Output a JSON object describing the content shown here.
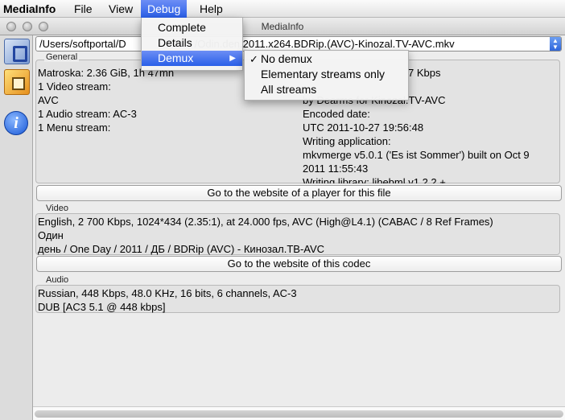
{
  "menubar": {
    "app_name": "MediaInfo",
    "items": [
      "File",
      "View",
      "Debug",
      "Help"
    ]
  },
  "window": {
    "title": "MediaInfo"
  },
  "path": {
    "value": "/Users/softportal/D",
    "value_tail": "/Odin.den.2011.x264.BDRip.(AVC)-Kinozal.TV-AVC.mkv"
  },
  "general": {
    "label": "General",
    "left_lines": [
      "Matroska: 2.36 GiB, 1h 47mn",
      "1 Video stream:",
      "AVC",
      "1 Audio stream: AC-3",
      "1 Menu stream:"
    ],
    "right_lines": [
      "7 Kbps",
      "by Dearms for Kinozal.TV-AVC",
      "Encoded date:",
      "UTC 2011-10-27 19:56:48",
      "Writing application:",
      "mkvmerge v5.0.1 ('Es ist Sommer') built on Oct  9",
      "2011 11:55:43",
      "Writing library: libebml v1.2.2 +"
    ],
    "button": "Go to the website of a player for this file"
  },
  "video": {
    "label": "Video",
    "lines": [
      "English, 2 700 Kbps, 1024*434 (2.35:1), at 24.000 fps, AVC (High@L4.1) (CABAC / 8 Ref Frames)",
      "Один",
      "день / One Day / 2011 / ДБ / BDRip (AVC) - Кинозал.ТВ-AVC"
    ],
    "button": "Go to the website of this codec"
  },
  "audio": {
    "label": "Audio",
    "lines": [
      "Russian, 448 Kbps, 48.0 KHz, 16 bits, 6 channels, AC-3",
      "DUB [AC3 5.1 @ 448 kbps]"
    ]
  },
  "debug_menu": {
    "items": [
      "Complete",
      "Details",
      "Demux"
    ],
    "highlighted": "Demux"
  },
  "demux_submenu": {
    "items": [
      "No demux",
      "Elementary streams only",
      "All streams"
    ],
    "checked": "No demux"
  },
  "colors": {
    "highlight": "#2a5fe8",
    "group_bg": "#e3e3e3"
  },
  "icons": [
    "open-file-icon",
    "export-icon",
    "info-icon"
  ]
}
